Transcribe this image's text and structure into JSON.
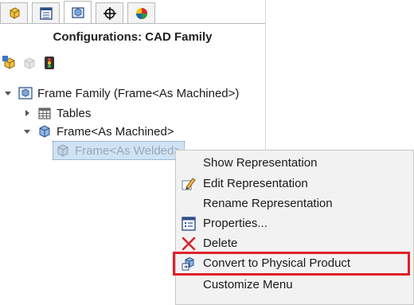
{
  "panel": {
    "title": "Configurations: CAD Family",
    "tabs": [
      {
        "icon": "part-icon"
      },
      {
        "icon": "property-manager-icon"
      },
      {
        "icon": "configuration-manager-icon",
        "active": true
      },
      {
        "icon": "crosshair-icon"
      },
      {
        "icon": "appearance-icon"
      }
    ],
    "toolbar": [
      {
        "icon": "add-representation-icon"
      },
      {
        "icon": "disabled-config-icon"
      },
      {
        "icon": "traffic-light-icon"
      }
    ]
  },
  "tree": {
    "root": {
      "label": "Frame Family  (Frame<As Machined>)"
    },
    "tables": {
      "label": "Tables"
    },
    "machined": {
      "label": "Frame<As Machined>"
    },
    "welded": {
      "label": "Frame<As Welded>"
    }
  },
  "context_menu": {
    "items": [
      {
        "label": "Show Representation",
        "icon": ""
      },
      {
        "label": "Edit Representation",
        "icon": "edit-pencil-icon"
      },
      {
        "label": "Rename Representation",
        "icon": ""
      },
      {
        "label": "Properties...",
        "icon": "properties-icon"
      },
      {
        "label": "Delete",
        "icon": "delete-x-icon"
      },
      {
        "label": "Convert to Physical Product",
        "icon": "convert-product-icon",
        "highlighted": true
      },
      {
        "label": "Customize Menu",
        "icon": ""
      }
    ]
  },
  "colors": {
    "highlight": "#e0202a",
    "selection": "#cfe3f5",
    "menu_background": "#f2f2f2"
  }
}
